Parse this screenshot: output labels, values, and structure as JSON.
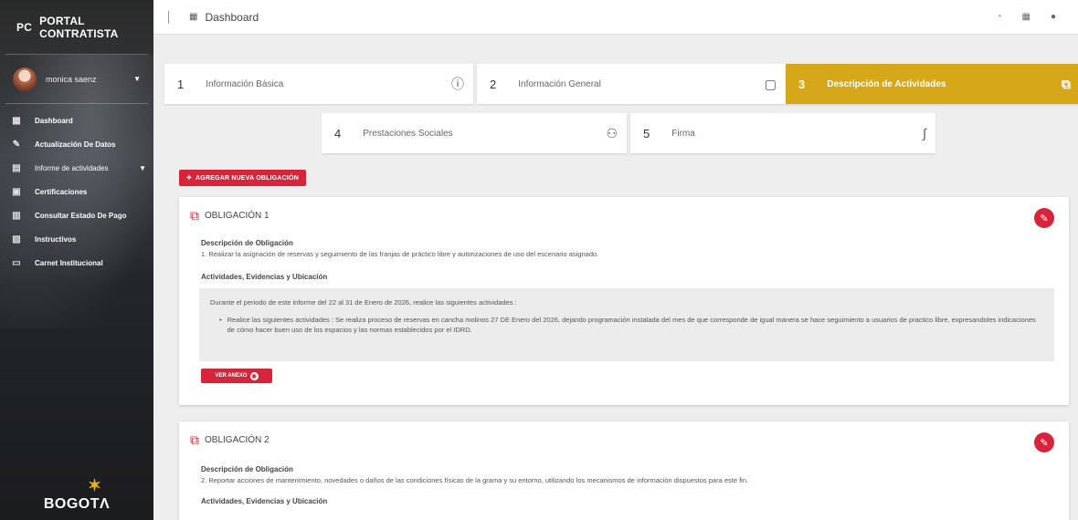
{
  "sidebar": {
    "brand_abbr": "PC",
    "brand_name": "PORTAL CONTRATISTA",
    "user_name": "monica saenz",
    "items": [
      {
        "label": "Dashboard"
      },
      {
        "label": "Actualización De Datos"
      },
      {
        "label": "Informe de actividades"
      },
      {
        "label": "Certificaciones"
      },
      {
        "label": "Consultar Estado De Pago"
      },
      {
        "label": "Instructivos"
      },
      {
        "label": "Carnet Institucional"
      }
    ],
    "logo_text": "BOGOTΛ"
  },
  "topbar": {
    "title": "Dashboard"
  },
  "steps": [
    {
      "num": "1",
      "label": "Información Básica"
    },
    {
      "num": "2",
      "label": "Información General"
    },
    {
      "num": "3",
      "label": "Descripción de Actividades"
    },
    {
      "num": "4",
      "label": "Prestaciones Sociales"
    },
    {
      "num": "5",
      "label": "Firma"
    }
  ],
  "add_button_label": "AGREGAR NUEVA OBLIGACIÓN",
  "obligations": [
    {
      "title": "OBLIGACIÓN 1",
      "desc_heading": "Descripción de Obligación",
      "desc_text": "1. Realizar la asignación de reservas y seguimiento de las franjas de práctico libre y autorizaciones de uso del escenario asignado.",
      "activities_heading": "Actividades, Evidencias y Ubicación",
      "period_text": "Durante el periodo de este informe del 22 al 31 de Enero de 2026, realice las siguientes actividades :",
      "bullet_text": "Realice las siguientes actividades : Se realiza proceso de reservas en cancha molinos 27 DE Enero del 2026, dejando programación instalada del mes de que corresponde de igual manera se hace seguimiento a usuarios de practico libre, expresandoles indicaciones de cómo hacer buen uso de los espacios y las normas establecidos por el IDRD.",
      "view_button": "VER ANEXO"
    },
    {
      "title": "OBLIGACIÓN 2",
      "desc_heading": "Descripción de Obligación",
      "desc_text": "2. Reportar acciones de mantenimiento, novedades o daños de las condiciones físicas de la grama y su entorno, utilizando los mecanismos de información dispuestos para este fin.",
      "activities_heading": "Actividades, Evidencias y Ubicación"
    }
  ]
}
